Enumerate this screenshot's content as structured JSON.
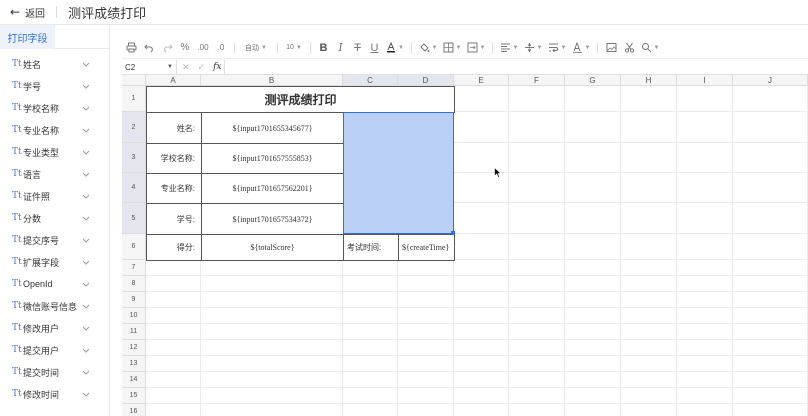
{
  "header": {
    "back_label": "返回",
    "title": "测评成绩打印"
  },
  "sidebar": {
    "tab_label": "打印字段",
    "field_icon_text": "Tt",
    "fields": [
      "姓名",
      "学号",
      "学校名称",
      "专业名称",
      "专业类型",
      "语言",
      "证件照",
      "分数",
      "提交序号",
      "扩展字段",
      "OpenId",
      "微信账号信息",
      "修改用户",
      "提交用户",
      "提交时间",
      "修改时间"
    ]
  },
  "toolbar": {
    "font_name": "自动",
    "font_size": "10",
    "items": [
      "print-icon",
      "undo-icon",
      "redo-icon",
      "percent-icon",
      "format-painter-icon",
      "bold-icon",
      "italic-icon",
      "strikethrough-icon",
      "underline-icon",
      "font-color-icon",
      "fill-color-icon",
      "border-icon",
      "merge-icon",
      "align-horizontal-icon",
      "align-vertical-icon",
      "text-wrap-icon",
      "text-rotate-icon",
      "image-icon",
      "clear-format-icon",
      "search-icon"
    ]
  },
  "formula_bar": {
    "cell_ref": "C2",
    "fx_label": "fx",
    "value": ""
  },
  "sheet": {
    "columns": [
      "A",
      "B",
      "C",
      "D",
      "E",
      "F",
      "G",
      "H",
      "I",
      "J"
    ],
    "rows": [
      "1",
      "2",
      "3",
      "4",
      "5",
      "6",
      "7",
      "8",
      "9",
      "10",
      "11",
      "12",
      "13",
      "14",
      "15",
      "16",
      "17"
    ],
    "selected_cell": "C2",
    "title": "测评成绩打印",
    "labels": {
      "name": "姓名:",
      "school": "学校名称:",
      "major": "专业名称:",
      "student_id": "学号:",
      "score": "得分:",
      "exam_time": "考试时间:"
    },
    "values": {
      "name": "${input1701655345677}",
      "school": "${input1701657555853}",
      "major": "${input1701657562201}",
      "student_id": "${input1701657534372}",
      "score": "${totalScore}",
      "exam_time": "${createTime}"
    }
  },
  "colors": {
    "accent": "#2f6fd6",
    "selection_fill": "#b9cff5",
    "sidebar_tab_bg": "#eef3fb",
    "header_bg": "#f5f5f5"
  }
}
